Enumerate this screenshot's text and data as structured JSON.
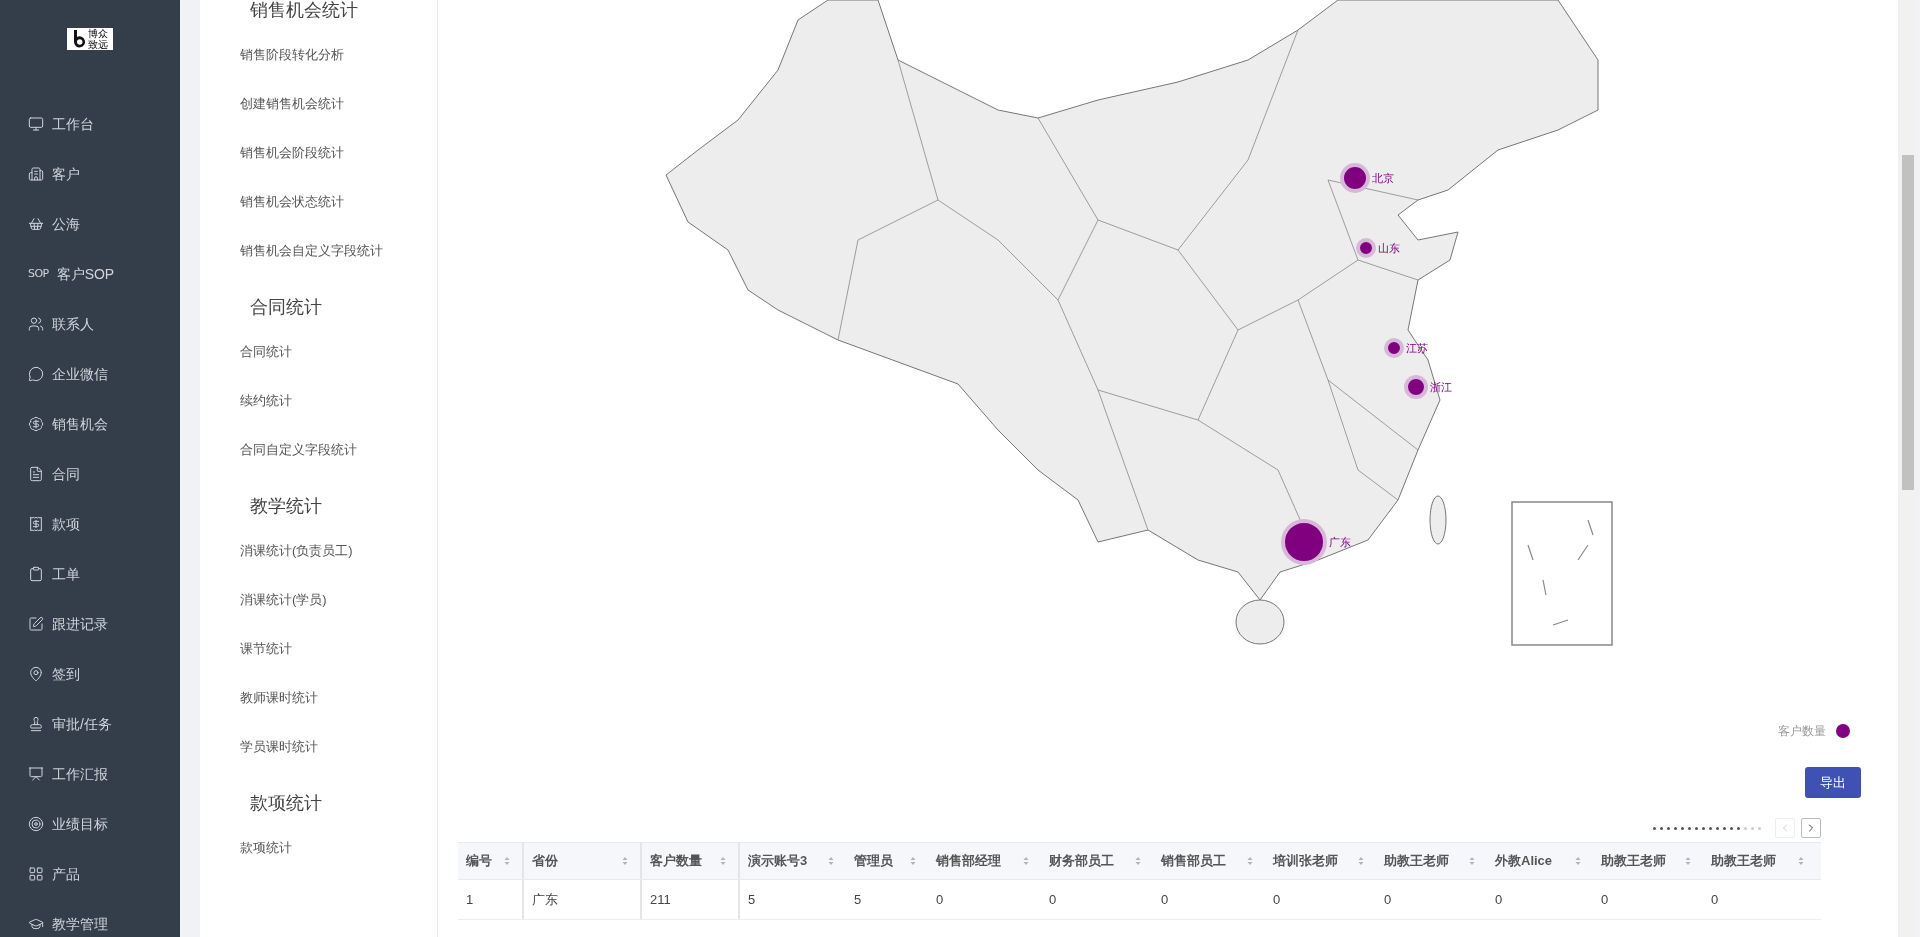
{
  "logo": {
    "line_1": "博众",
    "line_2": "致远"
  },
  "sidebar": {
    "items": [
      {
        "label": "工作台"
      },
      {
        "label": "客户"
      },
      {
        "label": "公海"
      },
      {
        "label": "客户SOP",
        "icon_text": "SOP"
      },
      {
        "label": "联系人"
      },
      {
        "label": "企业微信"
      },
      {
        "label": "销售机会"
      },
      {
        "label": "合同"
      },
      {
        "label": "款项"
      },
      {
        "label": "工单"
      },
      {
        "label": "跟进记录"
      },
      {
        "label": "签到"
      },
      {
        "label": "审批/任务"
      },
      {
        "label": "工作汇报"
      },
      {
        "label": "业绩目标"
      },
      {
        "label": "产品"
      },
      {
        "label": "教学管理"
      }
    ]
  },
  "submenu": {
    "sections": [
      {
        "title": "销售机会统计",
        "items": [
          "销售阶段转化分析",
          "创建销售机会统计",
          "销售机会阶段统计",
          "销售机会状态统计",
          "销售机会自定义字段统计"
        ]
      },
      {
        "title": "合同统计",
        "items": [
          "合同统计",
          "续约统计",
          "合同自定义字段统计"
        ]
      },
      {
        "title": "教学统计",
        "items": [
          "消课统计(负责员工)",
          "消课统计(学员)",
          "课节统计",
          "教师课时统计",
          "学员课时统计"
        ]
      },
      {
        "title": "款项统计",
        "items": [
          "款项统计"
        ]
      }
    ]
  },
  "map": {
    "markers": [
      {
        "label": "北京",
        "kind": "large"
      },
      {
        "label": "山东",
        "kind": "small"
      },
      {
        "label": "江苏",
        "kind": "small"
      },
      {
        "label": "浙江",
        "kind": "medium"
      },
      {
        "label": "广东",
        "kind": "huge"
      }
    ],
    "legend": {
      "label": "客户数量",
      "color": "#800080"
    }
  },
  "export_button": "导出",
  "pager": {
    "dots": [
      {
        "selected": true
      },
      {
        "selected": true
      },
      {
        "selected": true
      },
      {
        "selected": true
      },
      {
        "selected": true
      },
      {
        "selected": true
      },
      {
        "selected": true
      },
      {
        "selected": true
      },
      {
        "selected": true
      },
      {
        "selected": true
      },
      {
        "selected": true
      },
      {
        "selected": true
      },
      {
        "selected": true
      },
      {
        "selected": false
      },
      {
        "selected": false
      },
      {
        "selected": false
      }
    ],
    "prev_disabled": true,
    "next_disabled": false
  },
  "table": {
    "columns": [
      "编号",
      "省份",
      "客户数量",
      "演示账号3",
      "管理员",
      "销售部经理",
      "财务部员工",
      "销售部员工",
      "培训张老师",
      "助教王老师",
      "外教Alice",
      "助教王老师",
      "助教王老师"
    ],
    "rows": [
      [
        "1",
        "广东",
        "211",
        "5",
        "5",
        "0",
        "0",
        "0",
        "0",
        "0",
        "0",
        "0",
        "0"
      ]
    ]
  }
}
